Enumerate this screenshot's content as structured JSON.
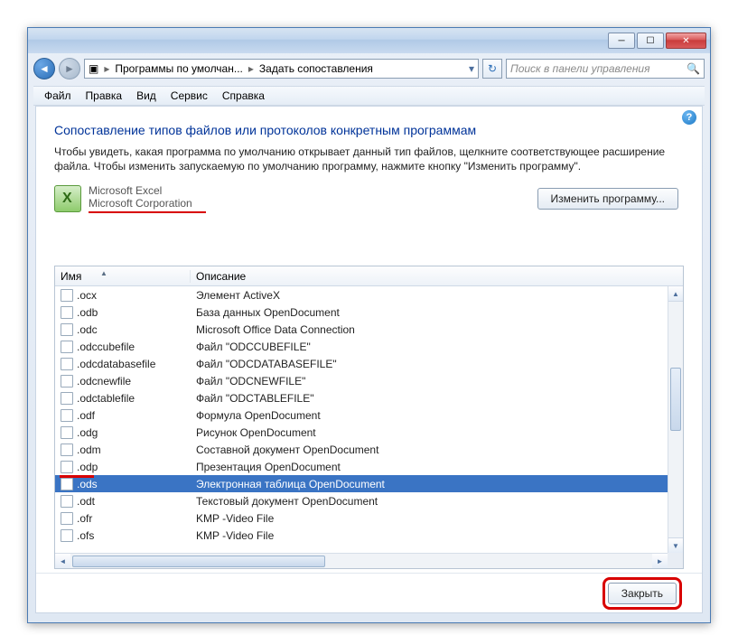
{
  "titlebar": {},
  "address": {
    "seg1": "Программы по умолчан...",
    "seg2": "Задать сопоставления"
  },
  "search": {
    "placeholder": "Поиск в панели управления"
  },
  "menu": {
    "file": "Файл",
    "edit": "Правка",
    "view": "Вид",
    "tools": "Сервис",
    "help": "Справка"
  },
  "heading": "Сопоставление типов файлов или протоколов конкретным программам",
  "body": "Чтобы увидеть, какая программа по умолчанию открывает данный тип файлов, щелкните соответствующее расширение файла. Чтобы изменить запускаемую по умолчанию программу, нажмите кнопку \"Изменить программу\".",
  "app": {
    "name": "Microsoft Excel",
    "vendor": "Microsoft Corporation"
  },
  "buttons": {
    "change": "Изменить программу...",
    "close": "Закрыть"
  },
  "columns": {
    "name": "Имя",
    "desc": "Описание"
  },
  "rows": [
    {
      "ext": ".ocx",
      "desc": "Элемент ActiveX"
    },
    {
      "ext": ".odb",
      "desc": "База данных OpenDocument"
    },
    {
      "ext": ".odc",
      "desc": "Microsoft Office Data Connection"
    },
    {
      "ext": ".odccubefile",
      "desc": "Файл \"ODCCUBEFILE\""
    },
    {
      "ext": ".odcdatabasefile",
      "desc": "Файл \"ODCDATABASEFILE\""
    },
    {
      "ext": ".odcnewfile",
      "desc": "Файл \"ODCNEWFILE\""
    },
    {
      "ext": ".odctablefile",
      "desc": "Файл \"ODCTABLEFILE\""
    },
    {
      "ext": ".odf",
      "desc": "Формула OpenDocument"
    },
    {
      "ext": ".odg",
      "desc": "Рисунок OpenDocument"
    },
    {
      "ext": ".odm",
      "desc": "Составной документ OpenDocument"
    },
    {
      "ext": ".odp",
      "desc": "Презентация OpenDocument"
    },
    {
      "ext": ".ods",
      "desc": "Электронная таблица OpenDocument",
      "selected": true
    },
    {
      "ext": ".odt",
      "desc": "Текстовый документ OpenDocument"
    },
    {
      "ext": ".ofr",
      "desc": "KMP -Video File"
    },
    {
      "ext": ".ofs",
      "desc": "KMP -Video File"
    }
  ]
}
